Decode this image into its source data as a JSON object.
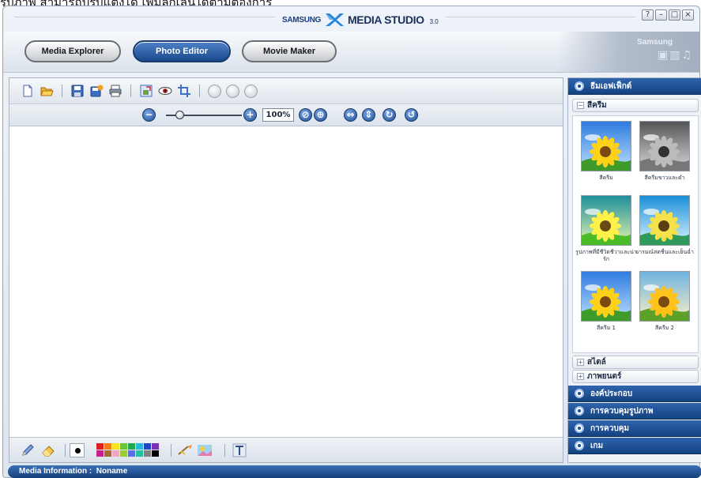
{
  "caption": "รูปภาพ สามารถปรับแต่งได้ เพิ่มลูกเล่นได้ตามต้องการ",
  "window": {
    "brand_samsung": "SAMSUNG",
    "brand_product": "MEDIA STUDIO",
    "brand_version": "3.0",
    "controls": {
      "help": "?",
      "minimize": "–",
      "maximize": "□",
      "close": "×"
    }
  },
  "tabs": [
    {
      "label": "Media Explorer",
      "active": false
    },
    {
      "label": "Photo Editor",
      "active": true
    },
    {
      "label": "Movie Maker",
      "active": false
    }
  ],
  "deco": {
    "text": "Samsung",
    "icons": "▣▥♫"
  },
  "zoom": {
    "value": "100%",
    "slider_level": 0.18
  },
  "right_panel": {
    "sections": [
      {
        "label": "ธีมเอฟเฟ็กต์",
        "expanded": true
      },
      {
        "label": "องค์ประกอบ"
      },
      {
        "label": "การควบคุมรูปภาพ"
      },
      {
        "label": "การควบคุม"
      },
      {
        "label": "เกม"
      }
    ],
    "subsections": [
      {
        "label": "สีครีม",
        "expanded": true
      },
      {
        "label": "สไตล์"
      },
      {
        "label": "ภาพยนตร์"
      }
    ],
    "thumbnails": [
      {
        "label": "สีครีม",
        "style": "color"
      },
      {
        "label": "สีครีมขาวและดำ",
        "style": "gray"
      },
      {
        "label": "รูปภาพที่มีชีวิตชีวาและน่ารัก",
        "style": "vivid"
      },
      {
        "label": "อารมณ์สดชื่นและเย็นฉ่ำ",
        "style": "cool"
      },
      {
        "label": "สีครีม 1",
        "style": "color"
      },
      {
        "label": "สีครีม 2",
        "style": "warm"
      }
    ]
  },
  "status": {
    "label": "Media Information :",
    "value": "Noname"
  },
  "palette_colors": [
    "#e02020",
    "#f07c1a",
    "#f5e31b",
    "#6cc23a",
    "#1fa84f",
    "#27b7d8",
    "#1f47c2",
    "#7a2fb8",
    "#c71f8e",
    "#a16a3a",
    "#f2a6c5",
    "#9acd32",
    "#5b6ee1",
    "#20c0a0",
    "#808080",
    "#000000"
  ],
  "accent": "#1b4a8d"
}
